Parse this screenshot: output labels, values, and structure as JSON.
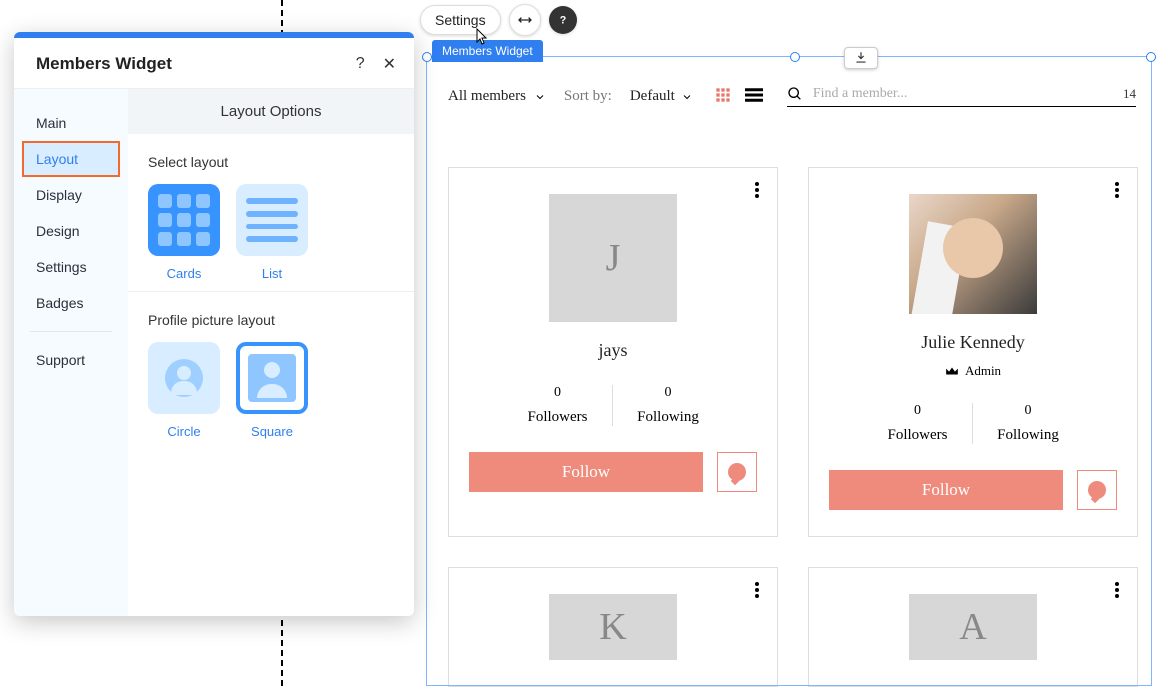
{
  "toolbar": {
    "settings_label": "Settings"
  },
  "widget_label": "Members Widget",
  "panel": {
    "title": "Members Widget",
    "help_glyph": "?",
    "close_glyph": "✕",
    "nav": {
      "main": "Main",
      "layout": "Layout",
      "display": "Display",
      "design": "Design",
      "settings": "Settings",
      "badges": "Badges",
      "support": "Support"
    },
    "content_header": "Layout Options",
    "select_layout_title": "Select layout",
    "layout_options": {
      "cards": "Cards",
      "list": "List"
    },
    "pic_layout_title": "Profile picture layout",
    "pic_options": {
      "circle": "Circle",
      "square": "Square"
    }
  },
  "members": {
    "filter_label": "All members",
    "sort_by_label": "Sort by:",
    "sort_value": "Default",
    "search_placeholder": "Find a member...",
    "count": "14",
    "follow_label": "Follow",
    "followers_label": "Followers",
    "following_label": "Following",
    "cards": [
      {
        "initial": "J",
        "name": "jays",
        "role": "",
        "followers": "0",
        "following": "0"
      },
      {
        "initial": "",
        "name": "Julie Kennedy",
        "role": "Admin",
        "followers": "0",
        "following": "0"
      },
      {
        "initial": "K",
        "name": "",
        "role": "",
        "followers": "",
        "following": ""
      },
      {
        "initial": "A",
        "name": "",
        "role": "",
        "followers": "",
        "following": ""
      }
    ]
  }
}
